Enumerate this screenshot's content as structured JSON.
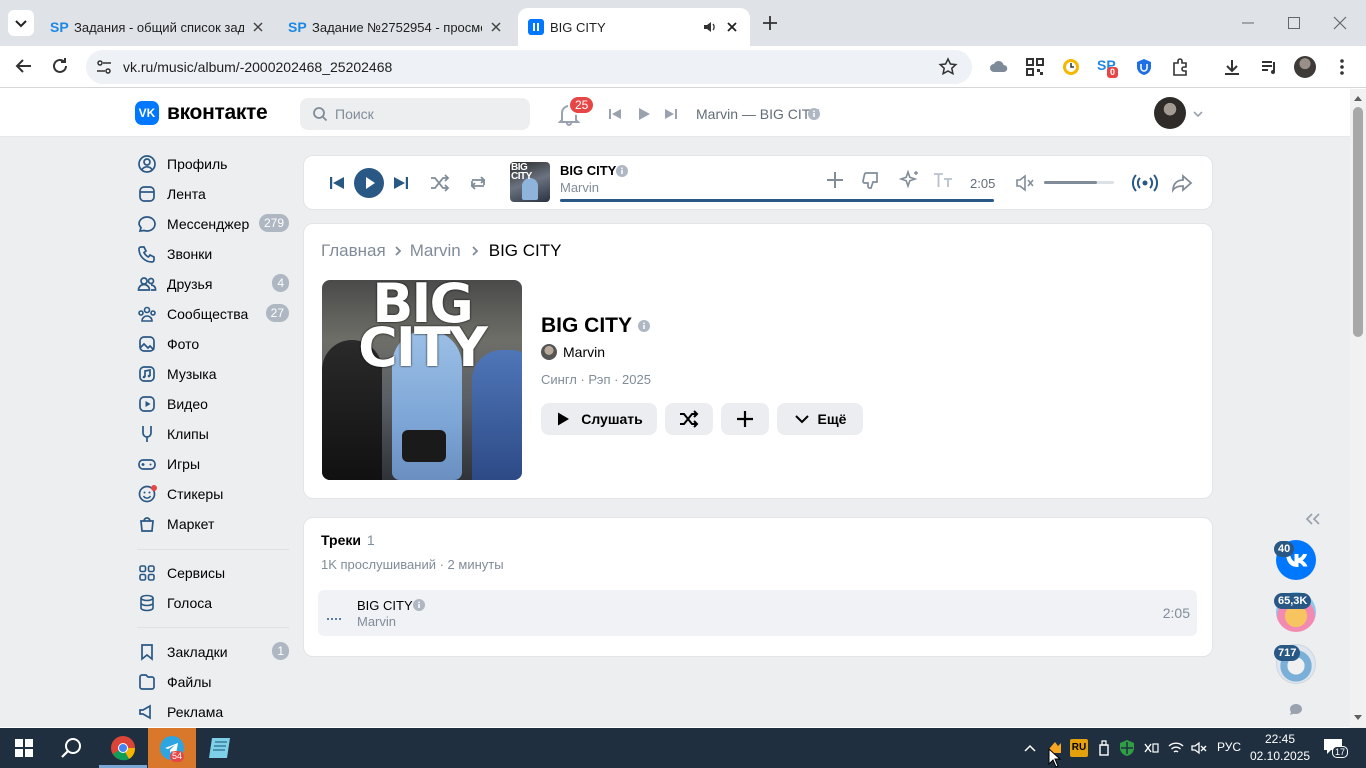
{
  "browser": {
    "tabs": [
      {
        "title": "Задания - общий список зада",
        "icon": "sp-icon"
      },
      {
        "title": "Задание №2752954 - просмо",
        "icon": "sp-icon"
      },
      {
        "title": "BIG CITY",
        "icon": "pause-icon"
      }
    ],
    "url": "vk.ru/music/album/-2000202468_25202468",
    "extension_badge": "0"
  },
  "vk": {
    "logo": "вконтакте",
    "search_placeholder": "Поиск",
    "notifications": "25",
    "header_track": "Marvin — BIG CITY",
    "nav": [
      {
        "label": "Профиль",
        "icon": "profile-icon",
        "badge": ""
      },
      {
        "label": "Лента",
        "icon": "feed-icon",
        "badge": ""
      },
      {
        "label": "Мессенджер",
        "icon": "messenger-icon",
        "badge": "279"
      },
      {
        "label": "Звонки",
        "icon": "phone-icon",
        "badge": ""
      },
      {
        "label": "Друзья",
        "icon": "friends-icon",
        "badge": "4"
      },
      {
        "label": "Сообщества",
        "icon": "communities-icon",
        "badge": "27"
      },
      {
        "label": "Фото",
        "icon": "photo-icon",
        "badge": ""
      },
      {
        "label": "Музыка",
        "icon": "music-icon",
        "badge": ""
      },
      {
        "label": "Видео",
        "icon": "video-icon",
        "badge": ""
      },
      {
        "label": "Клипы",
        "icon": "clips-icon",
        "badge": ""
      },
      {
        "label": "Игры",
        "icon": "games-icon",
        "badge": ""
      },
      {
        "label": "Стикеры",
        "icon": "stickers-icon",
        "badge": ""
      },
      {
        "label": "Маркет",
        "icon": "market-icon",
        "badge": ""
      }
    ],
    "nav2": [
      {
        "label": "Сервисы",
        "icon": "services-icon",
        "badge": ""
      },
      {
        "label": "Голоса",
        "icon": "votes-icon",
        "badge": ""
      }
    ],
    "nav3": [
      {
        "label": "Закладки",
        "icon": "bookmark-icon",
        "badge": "1"
      },
      {
        "label": "Файлы",
        "icon": "files-icon",
        "badge": ""
      },
      {
        "label": "Реклама",
        "icon": "ads-icon",
        "badge": ""
      }
    ],
    "player": {
      "title": "BIG CITY",
      "artist": "Marvin",
      "time": "2:05",
      "progress": 1.0,
      "volume": 0.75
    },
    "breadcrumb": [
      "Главная",
      "Marvin",
      "BIG CITY"
    ],
    "album": {
      "cover_text": "BIG CITY",
      "title": "BIG CITY",
      "artist": "Marvin",
      "meta": "Сингл · Рэп · 2025",
      "play_label": "Слушать",
      "more_label": "Ещё"
    },
    "tracks": {
      "heading": "Треки",
      "count": "1",
      "stats": "1K прослушиваний · 2 минуты",
      "items": [
        {
          "title": "BIG CITY",
          "artist": "Marvin",
          "duration": "2:05"
        }
      ]
    },
    "side_widgets": [
      "40",
      "65,3K",
      "717"
    ]
  },
  "taskbar": {
    "telegram_badge": "54",
    "lang": "РУС",
    "tray_lang": "RU",
    "time": "22:45",
    "date": "02.10.2025",
    "notif_count": "17"
  },
  "colors": {
    "vk_blue": "#0077ff",
    "accent": "#2a5885",
    "badge_red": "#e64646"
  }
}
